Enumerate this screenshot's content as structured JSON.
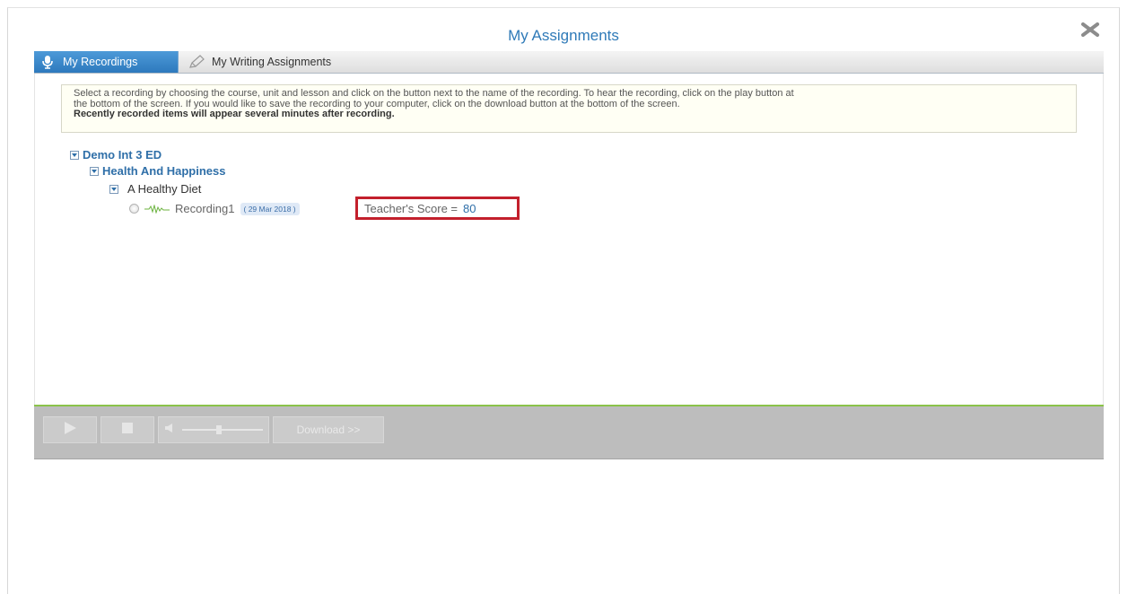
{
  "dialog": {
    "title": "My Assignments",
    "close_icon": "close-icon"
  },
  "tabs": [
    {
      "label": "My Recordings",
      "icon": "microphone-icon",
      "active": true
    },
    {
      "label": "My Writing Assignments",
      "icon": "pencil-icon",
      "active": false
    }
  ],
  "instructions": {
    "line1": "Select a recording by choosing the course, unit and lesson and click on the button next to the name of the recording. To hear the recording, click on the play button at",
    "line2": "the bottom of the screen. If you would like to save the recording to your computer, click on the download button at the bottom of the screen.",
    "note": "Recently recorded items will appear several minutes after recording."
  },
  "tree": {
    "course": "Demo Int 3 ED",
    "unit": "Health And Happiness",
    "lesson": "A Healthy Diet",
    "recording": {
      "name": "Recording1",
      "date": "( 29 Mar 2018 )",
      "score_label": "Teacher's Score =",
      "score_value": "80"
    }
  },
  "controls": {
    "download_label": "Download >>"
  },
  "colors": {
    "accent": "#2f7ab8",
    "highlight_box": "#c3202c",
    "divider": "#8bc34a"
  }
}
